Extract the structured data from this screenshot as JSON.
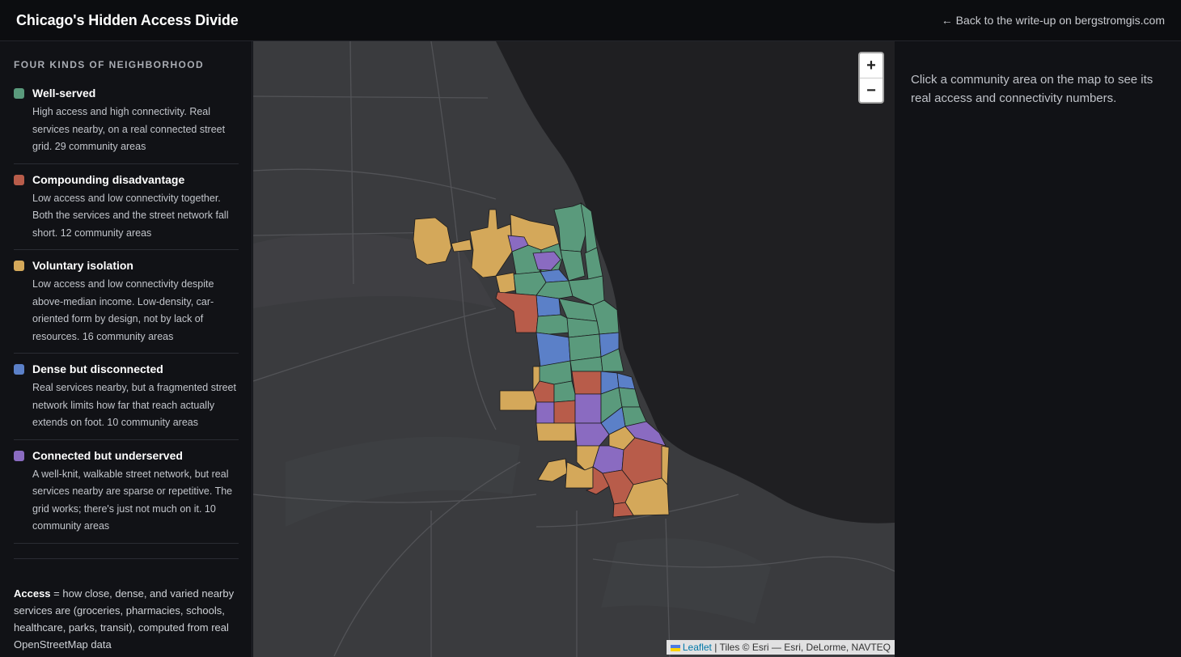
{
  "header": {
    "title": "Chicago's Hidden Access Divide",
    "back_link": "← Back to the write-up on bergstromgis.com"
  },
  "sidebar": {
    "section_title": "FOUR KINDS OF NEIGHBORHOOD",
    "legend": [
      {
        "name": "Well-served",
        "color": "#5a9a7c",
        "description": "High access and high connectivity. Real services nearby, on a real connected street grid. 29 community areas"
      },
      {
        "name": "Compounding disadvantage",
        "color": "#b85c4a",
        "description": "Low access and low connectivity together. Both the services and the street network fall short. 12 community areas"
      },
      {
        "name": "Voluntary isolation",
        "color": "#d4a85a",
        "description": "Low access and low connectivity despite above-median income. Low-density, car-oriented form by design, not by lack of resources. 16 community areas"
      },
      {
        "name": "Dense but disconnected",
        "color": "#5b80c8",
        "description": "Real services nearby, but a fragmented street network limits how far that reach actually extends on foot. 10 community areas"
      },
      {
        "name": "Connected but underserved",
        "color": "#8a6bc1",
        "description": "A well-knit, walkable street network, but real services nearby are sparse or repetitive. The grid works; there's just not much on it. 10 community areas"
      }
    ],
    "glossary": {
      "term": "Access",
      "definition": " = how close, dense, and varied nearby services are (groceries, pharmacies, schools, healthcare, parks, transit), computed from real OpenStreetMap data"
    }
  },
  "map": {
    "zoom_in": "+",
    "zoom_out": "−",
    "attribution_link": "Leaflet",
    "attribution_text": " | Tiles © Esri — Esri, DeLorme, NAVTEQ",
    "lake_color": "#1f1f22",
    "land_color": "#3a3b3e"
  },
  "info_panel": {
    "prompt": "Click a community area on the map to see its real access and connectivity numbers."
  }
}
